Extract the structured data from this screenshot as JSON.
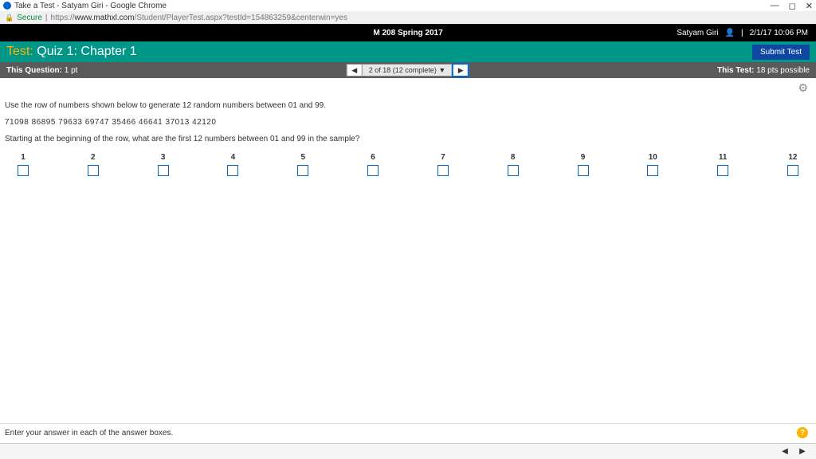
{
  "chrome": {
    "title": "Take a Test - Satyam Giri - Google Chrome",
    "secure": "Secure",
    "url_prefix": "https://",
    "url_domain": "www.mathxl.com",
    "url_path": "/Student/PlayerTest.aspx?testId=154863259&centerwin=yes"
  },
  "header": {
    "course": "M 208 Spring 2017",
    "user": "Satyam Giri",
    "datetime": "2/1/17 10:06 PM"
  },
  "test": {
    "label": "Test:",
    "title": "Quiz 1: Chapter 1",
    "submit": "Submit Test"
  },
  "qbar": {
    "left_label": "This Question:",
    "left_val": "1 pt",
    "nav_status": "2 of 18 (12 complete) ▼",
    "right_label": "This Test:",
    "right_val": "18 pts possible"
  },
  "body": {
    "prompt": "Use the row of numbers shown below to generate 12 random numbers between 01 and 99.",
    "numbers": "71098 86895 79633 69747 35466 46641 37013 42120",
    "question": "Starting at the beginning of the row, what are the first 12 numbers between 01 and 99 in the sample?",
    "labels": [
      "1",
      "2",
      "3",
      "4",
      "5",
      "6",
      "7",
      "8",
      "9",
      "10",
      "11",
      "12"
    ]
  },
  "footer": {
    "hint": "Enter your answer in each of the answer boxes."
  }
}
